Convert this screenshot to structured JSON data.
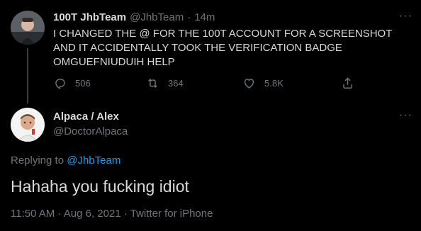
{
  "parent_tweet": {
    "display_name": "100T JhbTeam",
    "handle": "@JhbTeam",
    "separator": "·",
    "time": "14m",
    "text": "I CHANGED THE @ FOR THE 100T ACCOUNT FOR A SCREENSHOT AND IT ACCIDENTALLY TOOK THE VERIFICATION BADGE OMGUEFNIUDUIH HELP",
    "replies": "506",
    "retweets": "364",
    "likes": "5.8K",
    "more_label": "···"
  },
  "reply_tweet": {
    "display_name": "Alpaca / Alex",
    "handle": "@DoctorAlpaca",
    "replying_to_prefix": "Replying to",
    "replying_to_handle": "@JhbTeam",
    "text": "Hahaha you fucking idiot",
    "timestamp": "11:50 AM · Aug 6, 2021 · Twitter for iPhone",
    "more_label": "···"
  },
  "colors": {
    "background": "#000000",
    "text": "#d9d9d9",
    "muted": "#6e767d",
    "link": "#1d9bf0"
  }
}
